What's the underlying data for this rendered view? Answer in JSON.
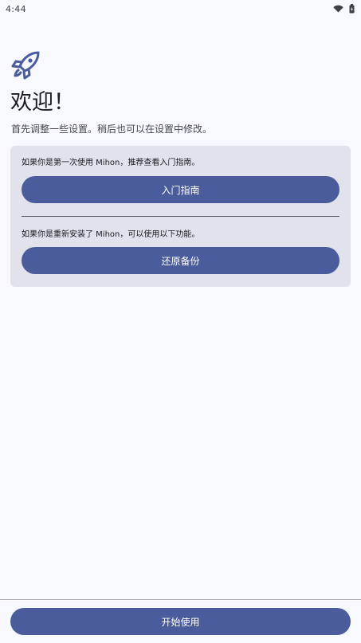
{
  "status_bar": {
    "time": "4:44",
    "icons": [
      "wifi-icon",
      "battery-icon"
    ]
  },
  "welcome": {
    "icon": "rocket-icon",
    "title": "欢迎！",
    "subtitle": "首先调整一些设置。稍后也可以在设置中修改。"
  },
  "card": {
    "guide_text": "如果你是第一次使用 Mihon，推荐查看入门指南。",
    "guide_button": "入门指南",
    "restore_text": "如果你是重新安装了 Mihon，可以使用以下功能。",
    "restore_button": "还原备份"
  },
  "footer": {
    "start_button": "开始使用"
  },
  "colors": {
    "background": "#f8f9ff",
    "card": "#e2e2ec",
    "primary": "#4a5c9c",
    "on_primary": "#ffffff",
    "text": "#1b1b21"
  }
}
